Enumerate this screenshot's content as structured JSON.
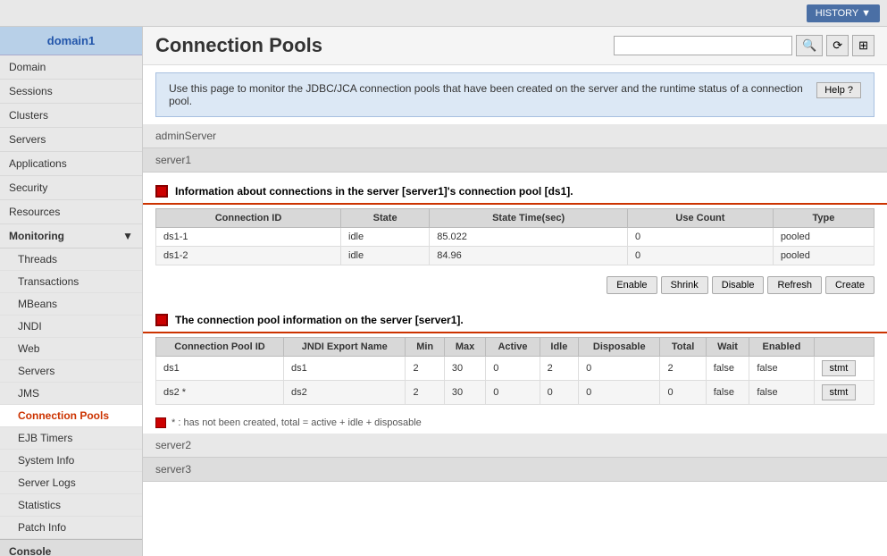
{
  "topBar": {
    "historyLabel": "HISTORY ▼"
  },
  "sidebar": {
    "domain": "domain1",
    "items": [
      {
        "label": "Domain",
        "name": "domain"
      },
      {
        "label": "Sessions",
        "name": "sessions"
      },
      {
        "label": "Clusters",
        "name": "clusters"
      },
      {
        "label": "Servers",
        "name": "servers"
      },
      {
        "label": "Applications",
        "name": "applications"
      },
      {
        "label": "Security",
        "name": "security"
      },
      {
        "label": "Resources",
        "name": "resources"
      }
    ],
    "monitoring": {
      "label": "Monitoring",
      "subitems": [
        {
          "label": "Threads",
          "name": "threads"
        },
        {
          "label": "Transactions",
          "name": "transactions"
        },
        {
          "label": "MBeans",
          "name": "mbeans"
        },
        {
          "label": "JNDI",
          "name": "jndi"
        },
        {
          "label": "Web",
          "name": "web"
        },
        {
          "label": "Servers",
          "name": "servers-mon"
        },
        {
          "label": "JMS",
          "name": "jms"
        },
        {
          "label": "Connection Pools",
          "name": "connection-pools",
          "active": true
        },
        {
          "label": "EJB Timers",
          "name": "ejb-timers"
        },
        {
          "label": "System Info",
          "name": "system-info"
        },
        {
          "label": "Server Logs",
          "name": "server-logs"
        },
        {
          "label": "Statistics",
          "name": "statistics"
        },
        {
          "label": "Patch Info",
          "name": "patch-info"
        }
      ]
    },
    "console": "Console"
  },
  "main": {
    "title": "Connection Pools",
    "search": {
      "placeholder": ""
    },
    "infoBox": {
      "text": "Use this page to monitor the JDBC/JCA connection pools that have been created on the server and the runtime status of a connection pool.",
      "helpLabel": "Help ?"
    },
    "serverRows": [
      "adminServer",
      "server1"
    ],
    "section1": {
      "title": "Information about connections in the server [server1]'s connection pool [ds1].",
      "columns": [
        "Connection ID",
        "State",
        "State Time(sec)",
        "Use Count",
        "Type"
      ],
      "rows": [
        {
          "connectionId": "ds1-1",
          "state": "idle",
          "stateTime": "85.022",
          "useCount": "0",
          "type": "pooled"
        },
        {
          "connectionId": "ds1-2",
          "state": "idle",
          "stateTime": "84.96",
          "useCount": "0",
          "type": "pooled"
        }
      ],
      "buttons": [
        "Enable",
        "Shrink",
        "Disable",
        "Refresh",
        "Create"
      ]
    },
    "section2": {
      "title": "The connection pool information on the server [server1].",
      "columns": [
        "Connection Pool ID",
        "JNDI Export Name",
        "Min",
        "Max",
        "Active",
        "Idle",
        "Disposable",
        "Total",
        "Wait",
        "Enabled"
      ],
      "rows": [
        {
          "poolId": "ds1",
          "jndi": "ds1",
          "min": "2",
          "max": "30",
          "active": "0",
          "idle": "2",
          "disposable": "0",
          "total": "2",
          "wait": "false",
          "enabled": "false",
          "stmt": "stmt"
        },
        {
          "poolId": "ds2 *",
          "jndi": "ds2",
          "min": "2",
          "max": "30",
          "active": "0",
          "idle": "0",
          "disposable": "0",
          "total": "0",
          "wait": "false",
          "enabled": "false",
          "stmt": "stmt"
        }
      ]
    },
    "noteText": "* : has not been created, total = active + idle + disposable",
    "bottomServers": [
      "server2",
      "server3"
    ]
  }
}
